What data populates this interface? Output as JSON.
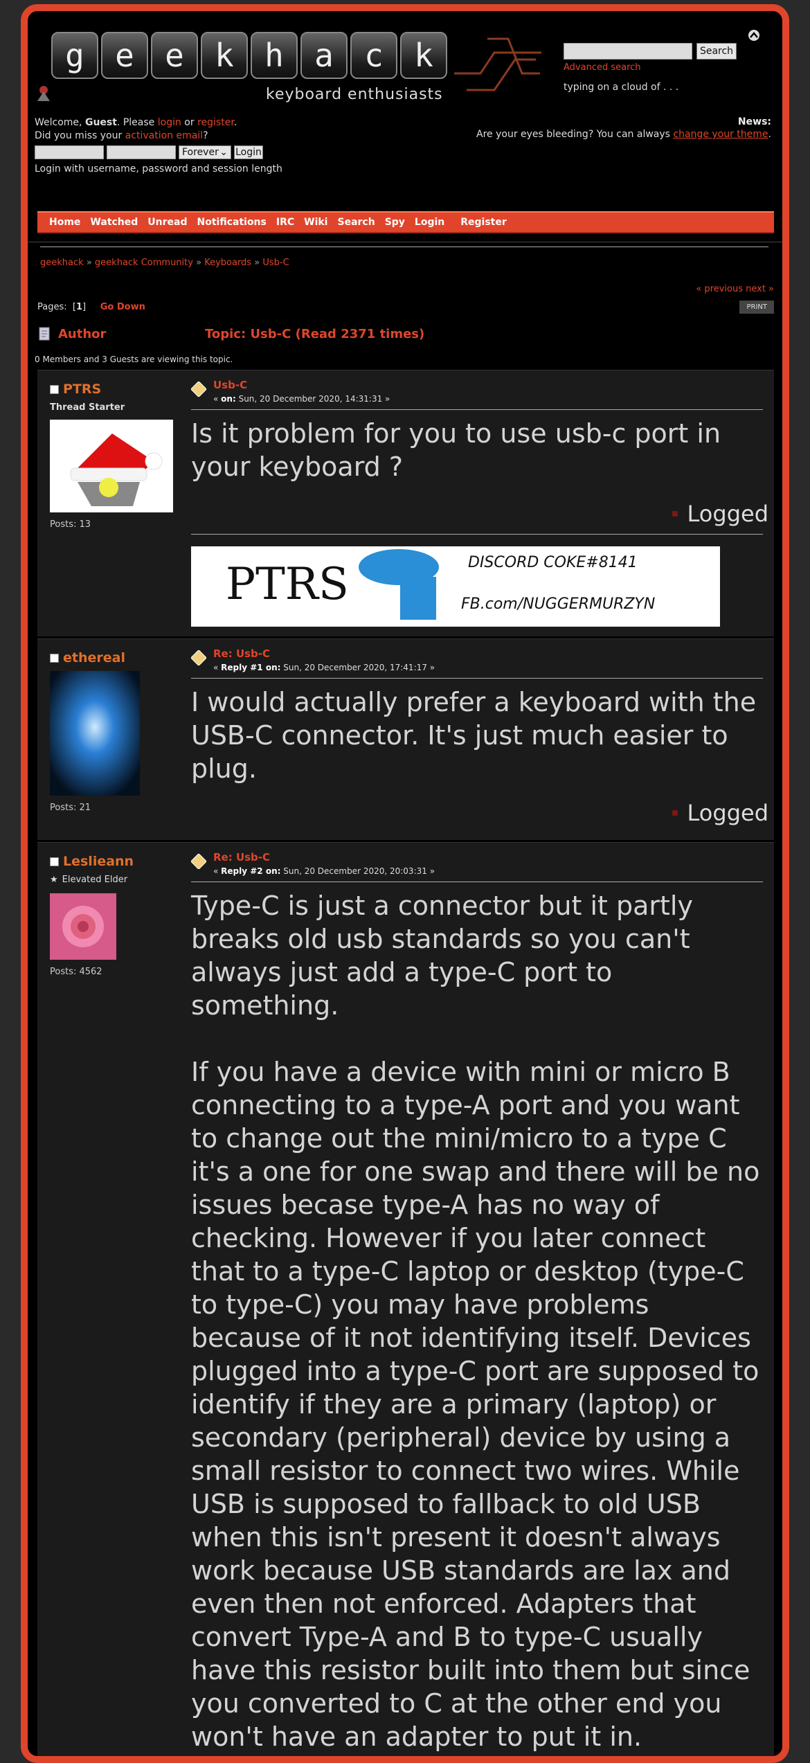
{
  "site": {
    "logo_letters": [
      "g",
      "e",
      "e",
      "k",
      "h",
      "a",
      "c",
      "k"
    ],
    "tagline": "keyboard enthusiasts",
    "search_button": "Search",
    "advanced_search": "Advanced search",
    "slogan": "typing on a cloud of . . .",
    "news_label": "News:",
    "news_text": "Are your eyes bleeding?  You can always ",
    "news_link": "change your theme",
    "news_end": "."
  },
  "login": {
    "welcome_prefix": "Welcome, ",
    "guest": "Guest",
    "please": ". Please ",
    "login_link": "login",
    "or": " or ",
    "register_link": "register",
    "end": ".",
    "missed_prefix": "Did you miss your ",
    "activation_link": "activation email",
    "missed_end": "?",
    "session_option": "Forever",
    "login_button": "Login",
    "hint": "Login with username, password and session length"
  },
  "nav": [
    "Home",
    "Watched",
    "Unread",
    "Notifications",
    "IRC",
    "Wiki",
    "Search",
    "Spy",
    "Login",
    "Register"
  ],
  "breadcrumb": [
    "geekhack",
    "geekhack Community",
    "Keyboards",
    "Usb-C"
  ],
  "breadcrumb_sep": "»",
  "pagination": {
    "prev_next": "« previous next »",
    "pages_label": "Pages:",
    "current": "1",
    "go_down": "Go Down",
    "print": "PRINT"
  },
  "topic": {
    "author_header": "Author",
    "title": "Topic: Usb-C  (Read 2371 times)",
    "viewing": "0 Members and 3 Guests are viewing this topic."
  },
  "posts": [
    {
      "name": "PTRS",
      "rank": "Thread Starter",
      "posts": "Posts: 13",
      "subject": "Usb-C",
      "meta_label": "on:",
      "meta_prefix": "« ",
      "meta_date": "Sun, 20 December 2020, 14:31:31 »",
      "body": "Is it problem for you to use usb-c port in your keyboard ?",
      "logged": "Logged",
      "signature_text": "PTRS",
      "signature_extra": "DISCORD COKE#8141",
      "signature_fb": "FB.com/NUGGERMURZYN"
    },
    {
      "name": "ethereal",
      "rank": "",
      "posts": "Posts: 21",
      "subject": "Re: Usb-C",
      "meta_label": "Reply #1 on:",
      "meta_prefix": "« ",
      "meta_date": "Sun, 20 December 2020, 17:41:17 »",
      "body": "I would actually prefer a keyboard with the USB-C connector. It's just much easier to plug.",
      "logged": "Logged"
    },
    {
      "name": "Leslieann",
      "rank": "Elevated Elder",
      "posts": "Posts: 4562",
      "subject": "Re: Usb-C",
      "meta_label": "Reply #2 on:",
      "meta_prefix": "« ",
      "meta_date": "Sun, 20 December 2020, 20:03:31 »",
      "body": "Type-C is just a connector but it partly breaks old usb standards so you can't always just add a type-C port to something.\n\nIf you have a device with mini or micro B connecting to a type-A port and you want to change out the mini/micro to a type C it's a one for one swap and there will be no issues becase type-A has no way of checking. However if you later connect that to a type-C laptop or desktop (type-C to type-C) you may have problems because of it not identifying itself. Devices plugged into a type-C port are supposed to identify if they are a primary (laptop) or secondary (peripheral) device by using a small resistor to connect two wires. While USB is supposed to fallback to old USB when this isn't present it doesn't always work because USB standards are lax and even then not enforced. Adapters that convert Type-A and B to type-C usually have this resistor built into them but since you converted to C at the other end you won't have an adapter to put it in."
    }
  ],
  "colors": {
    "accent": "#e0452b",
    "username": "#e0702b",
    "post_bg": "#1b1b1b"
  }
}
